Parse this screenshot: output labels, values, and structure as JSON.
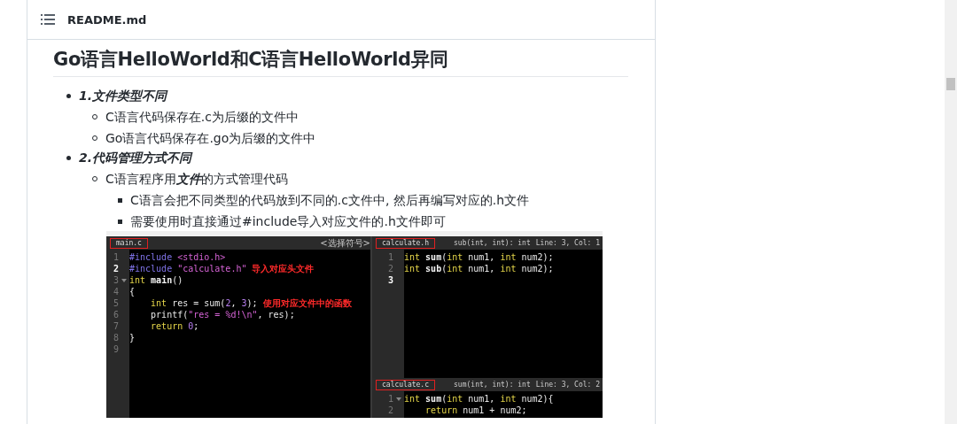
{
  "header": {
    "title": "README.md"
  },
  "heading": "Go语言HelloWorld和C语言HelloWorld异同",
  "outline": [
    {
      "text": "1.文件类型不同",
      "children": [
        {
          "text": "C语言代码保存在.c为后缀的文件中"
        },
        {
          "text": "Go语言代码保存在.go为后缀的文件中"
        }
      ]
    },
    {
      "text": "2.代码管理方式不同",
      "children": [
        {
          "text": "C语言程序用**文件**的方式管理代码",
          "children": [
            {
              "text": "C语言会把不同类型的代码放到不同的.c文件中, 然后再编写对应的.h文件"
            },
            {
              "text": "需要使用时直接通过#include导入对应文件的.h文件即可"
            }
          ]
        }
      ]
    }
  ],
  "editor": {
    "panes": [
      {
        "tab": "main.c",
        "symbol": "<选择符号>",
        "lines": [
          {
            "number": "1",
            "current": false,
            "foldable": false,
            "tokens": [
              {
                "text": "#include ",
                "kind": "pp"
              },
              {
                "text": "<stdio.h>",
                "kind": "str"
              }
            ]
          },
          {
            "number": "2",
            "current": true,
            "foldable": false,
            "note": "导入对应头文件",
            "tokens": [
              {
                "text": "#include ",
                "kind": "pp"
              },
              {
                "text": "\"calculate.h\"",
                "kind": "str"
              }
            ]
          },
          {
            "number": "3",
            "current": false,
            "foldable": true,
            "tokens": [
              {
                "text": "int ",
                "kind": "kw"
              },
              {
                "text": "main",
                "kind": "fn"
              },
              {
                "text": "()",
                "kind": "plain"
              }
            ]
          },
          {
            "number": "4",
            "current": false,
            "foldable": false,
            "tokens": [
              {
                "text": "{",
                "kind": "plain"
              }
            ]
          },
          {
            "number": "5",
            "current": false,
            "foldable": false,
            "note": "使用对应文件中的函数",
            "tokens": [
              {
                "text": "    int ",
                "kind": "kw"
              },
              {
                "text": "res = sum(",
                "kind": "plain"
              },
              {
                "text": "2",
                "kind": "num"
              },
              {
                "text": ", ",
                "kind": "plain"
              },
              {
                "text": "3",
                "kind": "num"
              },
              {
                "text": ");",
                "kind": "plain"
              }
            ]
          },
          {
            "number": "6",
            "current": false,
            "foldable": false,
            "tokens": [
              {
                "text": "    printf(",
                "kind": "plain"
              },
              {
                "text": "\"res = %d!\\n\"",
                "kind": "str"
              },
              {
                "text": ", res);",
                "kind": "plain"
              }
            ]
          },
          {
            "number": "7",
            "current": false,
            "foldable": false,
            "tokens": [
              {
                "text": "    return ",
                "kind": "kw"
              },
              {
                "text": "0",
                "kind": "num"
              },
              {
                "text": ";",
                "kind": "plain"
              }
            ]
          },
          {
            "number": "8",
            "current": false,
            "foldable": false,
            "tokens": [
              {
                "text": "}",
                "kind": "plain"
              }
            ]
          },
          {
            "number": "9",
            "current": false,
            "foldable": false
          }
        ]
      },
      {
        "tab": "calculate.h",
        "symbol": "sub(int, int): int",
        "position": "Line: 3, Col: 1",
        "lines": [
          {
            "number": "1",
            "current": false,
            "foldable": false,
            "tokens": [
              {
                "text": "int ",
                "kind": "kw"
              },
              {
                "text": "sum",
                "kind": "fn"
              },
              {
                "text": "(",
                "kind": "plain"
              },
              {
                "text": "int ",
                "kind": "kw"
              },
              {
                "text": "num1, ",
                "kind": "plain"
              },
              {
                "text": "int ",
                "kind": "kw"
              },
              {
                "text": "num2);",
                "kind": "plain"
              }
            ]
          },
          {
            "number": "2",
            "current": false,
            "foldable": false,
            "tokens": [
              {
                "text": "int ",
                "kind": "kw"
              },
              {
                "text": "sub",
                "kind": "fn"
              },
              {
                "text": "(",
                "kind": "plain"
              },
              {
                "text": "int ",
                "kind": "kw"
              },
              {
                "text": "num1, ",
                "kind": "plain"
              },
              {
                "text": "int ",
                "kind": "kw"
              },
              {
                "text": "num2);",
                "kind": "plain"
              }
            ]
          },
          {
            "number": "3",
            "current": true,
            "foldable": false
          }
        ]
      },
      {
        "tab": "calculate.c",
        "symbol": "sum(int, int): int",
        "position": "Line: 3, Col: 2",
        "lines": [
          {
            "number": "1",
            "current": false,
            "foldable": true,
            "tokens": [
              {
                "text": "int ",
                "kind": "kw"
              },
              {
                "text": "sum",
                "kind": "fn"
              },
              {
                "text": "(",
                "kind": "plain"
              },
              {
                "text": "int ",
                "kind": "kw"
              },
              {
                "text": "num1, ",
                "kind": "plain"
              },
              {
                "text": "int ",
                "kind": "kw"
              },
              {
                "text": "num2){",
                "kind": "plain"
              }
            ]
          },
          {
            "number": "2",
            "current": false,
            "foldable": false,
            "tokens": [
              {
                "text": "    return ",
                "kind": "kw"
              },
              {
                "text": "num1 + num2;",
                "kind": "plain"
              }
            ]
          }
        ]
      }
    ]
  }
}
